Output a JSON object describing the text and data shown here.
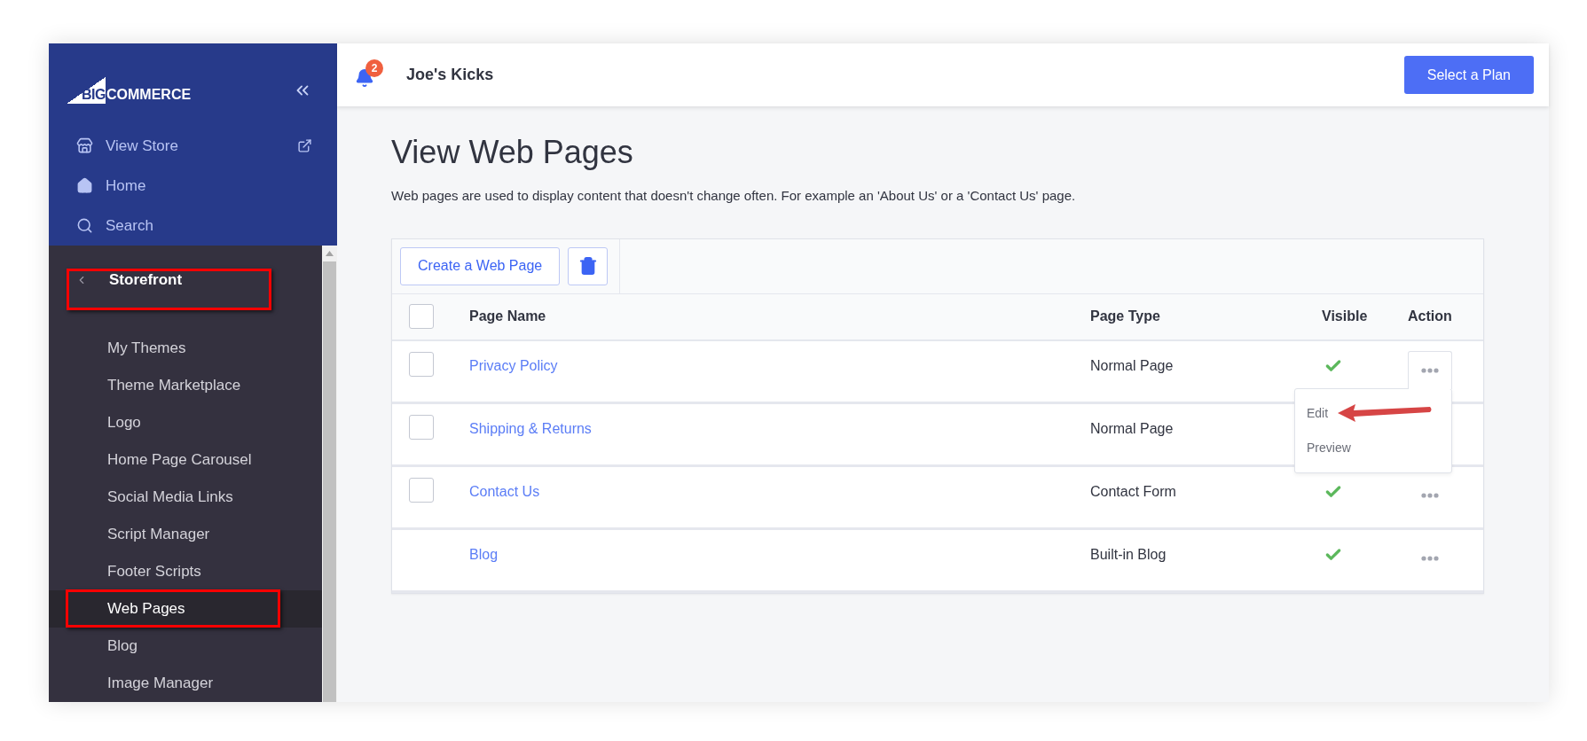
{
  "logo": {
    "prefix": "BIG",
    "name": "COMMERCE"
  },
  "sidebar": {
    "top_items": [
      {
        "label": "View Store",
        "kind": "store"
      },
      {
        "label": "Home",
        "kind": "home"
      },
      {
        "label": "Search",
        "kind": "search"
      }
    ],
    "section": {
      "label": "Storefront",
      "highlighted": true
    },
    "items": [
      {
        "label": "My Themes",
        "selected": false,
        "highlighted": false
      },
      {
        "label": "Theme Marketplace",
        "selected": false,
        "highlighted": false
      },
      {
        "label": "Logo",
        "selected": false,
        "highlighted": false
      },
      {
        "label": "Home Page Carousel",
        "selected": false,
        "highlighted": false
      },
      {
        "label": "Social Media Links",
        "selected": false,
        "highlighted": false
      },
      {
        "label": "Script Manager",
        "selected": false,
        "highlighted": false
      },
      {
        "label": "Footer Scripts",
        "selected": false,
        "highlighted": false
      },
      {
        "label": "Web Pages",
        "selected": true,
        "highlighted": true
      },
      {
        "label": "Blog",
        "selected": false,
        "highlighted": false
      },
      {
        "label": "Image Manager",
        "selected": false,
        "highlighted": false
      }
    ]
  },
  "header": {
    "notifications": "2",
    "store_name": "Joe's Kicks",
    "button": "Select a Plan"
  },
  "page": {
    "title": "View Web Pages",
    "description": "Web pages are used to display content that doesn't change often. For example an 'About Us' or a 'Contact Us' page."
  },
  "toolbar": {
    "create_button": "Create a Web Page"
  },
  "table": {
    "header_checked": false,
    "columns": [
      "Page Name",
      "Page Type",
      "Visible",
      "Action"
    ],
    "rows": [
      {
        "kind": "custom",
        "name": "Privacy Policy",
        "type": "Normal Page",
        "checked": false,
        "visible": true,
        "menu_open": true
      },
      {
        "kind": "custom",
        "name": "Shipping & Returns",
        "type": "Normal Page",
        "checked": false
      },
      {
        "kind": "custom",
        "name": "Contact Us",
        "type": "Contact Form",
        "checked": false,
        "visible": true,
        "menu_open": false
      },
      {
        "kind": "builtin",
        "name": "Blog",
        "type": "Built-in Blog",
        "visible": true,
        "menu_open": false
      }
    ],
    "action_menu": [
      "Edit",
      "Preview"
    ]
  }
}
